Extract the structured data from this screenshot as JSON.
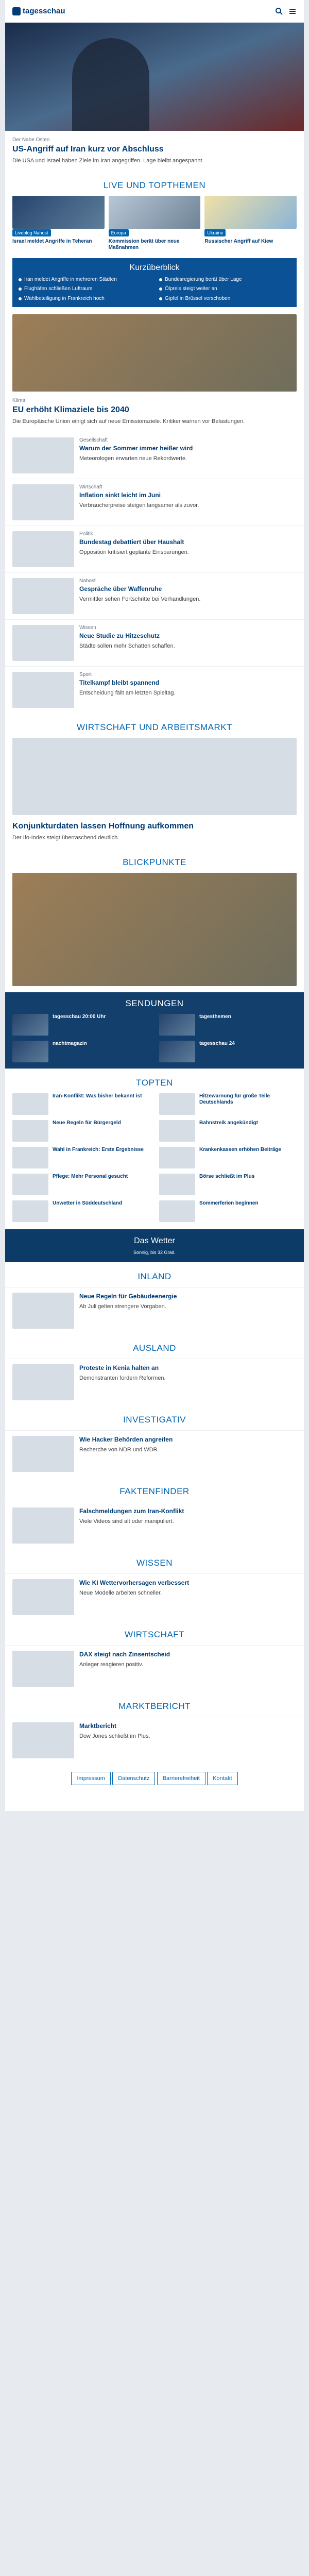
{
  "site": {
    "name": "tagesschau",
    "menu_label": "Menü",
    "search_label": "Suche"
  },
  "hero": {
    "kicker": "Der Nahe Osten",
    "title": "US-Angriff auf Iran kurz vor Abschluss",
    "text": "Die USA und Israel haben Ziele im Iran angegriffen. Lage bleibt angespannt."
  },
  "live": {
    "title": "Live und Topthemen",
    "cards": [
      {
        "label": "Liveblog Nahost",
        "title": "Israel meldet Angriffe in Teheran"
      },
      {
        "label": "Europa",
        "title": "Kommission berät über neue Maßnahmen"
      },
      {
        "label": "Ukraine",
        "title": "Russischer Angriff auf Kiew"
      }
    ]
  },
  "summary": {
    "title": "Kurzüberblick",
    "items": [
      "Iran meldet Angriffe in mehreren Städten",
      "Bundesregierung berät über Lage",
      "Flughäfen schließen Luftraum",
      "Ölpreis steigt weiter an",
      "Wahlbeteiligung in Frankreich hoch",
      "Gipfel in Brüssel verschoben"
    ]
  },
  "lead": {
    "kicker": "Klima",
    "title": "EU erhöht Klimaziele bis 2040",
    "text": "Die Europäische Union einigt sich auf neue Emissionsziele. Kritiker warnen vor Belastungen."
  },
  "stories": [
    {
      "kicker": "Gesellschaft",
      "title": "Warum der Sommer immer heißer wird",
      "text": "Meteorologen erwarten neue Rekordwerte."
    },
    {
      "kicker": "Wirtschaft",
      "title": "Inflation sinkt leicht im Juni",
      "text": "Verbraucherpreise steigen langsamer als zuvor."
    },
    {
      "kicker": "Politik",
      "title": "Bundestag debattiert über Haushalt",
      "text": "Opposition kritisiert geplante Einsparungen."
    },
    {
      "kicker": "Nahost",
      "title": "Gespräche über Waffenruhe",
      "text": "Vermittler sehen Fortschritte bei Verhandlungen."
    },
    {
      "kicker": "Wissen",
      "title": "Neue Studie zu Hitzeschutz",
      "text": "Städte sollen mehr Schatten schaffen."
    },
    {
      "kicker": "Sport",
      "title": "Titelkampf bleibt spannend",
      "text": "Entscheidung fällt am letzten Spieltag."
    }
  ],
  "sections": {
    "economy": "Wirtschaft und Arbeitsmarkt",
    "focus": "Blickpunkte",
    "broadcasts": "Sendungen",
    "top": "Topten",
    "inland": "Inland",
    "abroad": "Ausland",
    "investigative": "Investigativ",
    "factfinder": "Faktenfinder",
    "knowledge": "Wissen",
    "business": "Wirtschaft",
    "market": "Marktbericht"
  },
  "economy": {
    "title": "Konjunkturdaten lassen Hoffnung aufkommen",
    "text": "Der Ifo-Index steigt überraschend deutlich."
  },
  "broadcasts": [
    {
      "title": "tagesschau 20:00 Uhr"
    },
    {
      "title": "tagesthemen"
    },
    {
      "title": "nachtmagazin"
    },
    {
      "title": "tagesschau 24"
    }
  ],
  "topten": [
    "Iran-Konflikt: Was bisher bekannt ist",
    "Hitzewarnung für große Teile Deutschlands",
    "Neue Regeln für Bürgergeld",
    "Bahnstreik angekündigt",
    "Wahl in Frankreich: Erste Ergebnisse",
    "Krankenkassen erhöhen Beiträge",
    "Pflege: Mehr Personal gesucht",
    "Börse schließt im Plus",
    "Unwetter in Süddeutschland",
    "Sommerferien beginnen"
  ],
  "weather": {
    "title": "Das Wetter",
    "text": "Sonnig, bis 32 Grad."
  },
  "inland": {
    "title": "Neue Regeln für Gebäudeenergie",
    "text": "Ab Juli gelten strengere Vorgaben."
  },
  "abroad": {
    "title": "Proteste in Kenia halten an",
    "text": "Demonstranten fordern Reformen."
  },
  "investigative": {
    "title": "Wie Hacker Behörden angreifen",
    "text": "Recherche von NDR und WDR."
  },
  "factfinder": {
    "title": "Falschmeldungen zum Iran-Konflikt",
    "text": "Viele Videos sind alt oder manipuliert."
  },
  "knowledge": {
    "title": "Wie KI Wettervorhersagen verbessert",
    "text": "Neue Modelle arbeiten schneller."
  },
  "business": {
    "title": "DAX steigt nach Zinsentscheid",
    "text": "Anleger reagieren positiv."
  },
  "market": {
    "title": "Marktbericht",
    "text": "Dow Jones schließt im Plus."
  },
  "footer": {
    "links": [
      "Impressum",
      "Datenschutz",
      "Barrierefreiheit",
      "Kontakt"
    ]
  },
  "colors": {
    "primary": "#003c75",
    "accent": "#0066b3",
    "band": "#123f6b"
  }
}
